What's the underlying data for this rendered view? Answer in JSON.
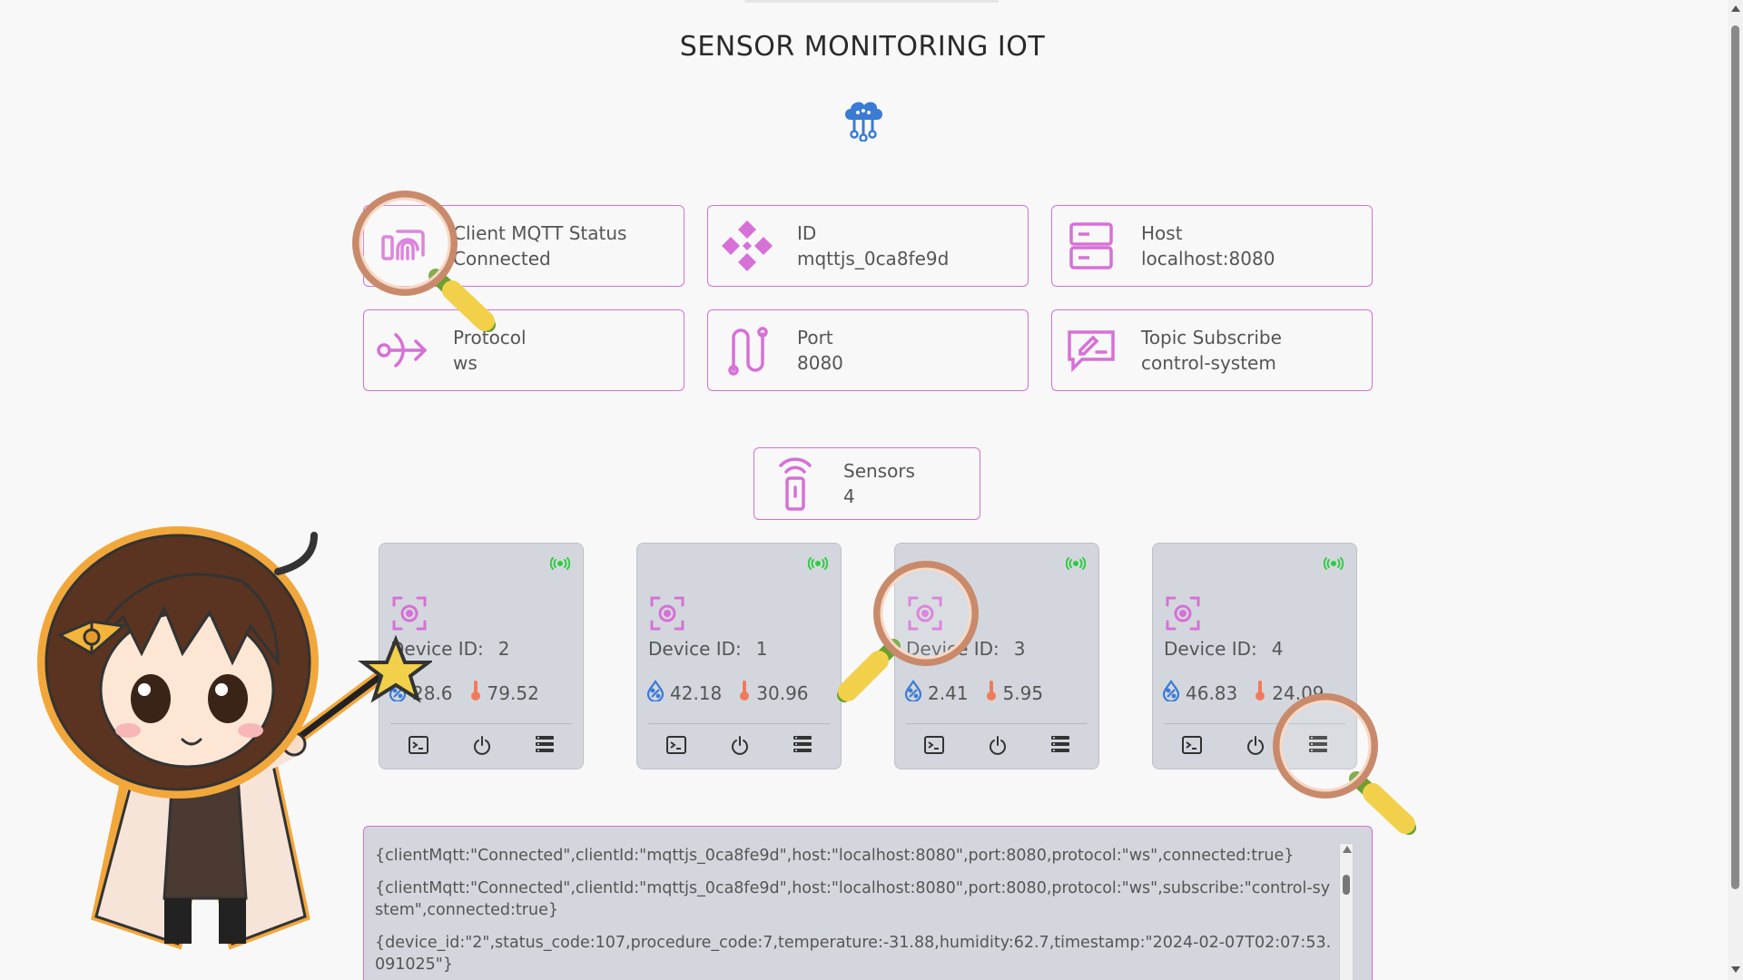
{
  "page": {
    "title": "SENSOR MONITORING IOT"
  },
  "icons": {
    "logo": "cloud-network-icon"
  },
  "info_cards": [
    {
      "label": "Client MQTT Status",
      "value": "Connected",
      "icon": "fingerprint-device-icon"
    },
    {
      "label": "ID",
      "value": "mqttjs_0ca8fe9d",
      "icon": "diamond-arrows-icon"
    },
    {
      "label": "Host",
      "value": "localhost:8080",
      "icon": "server-icon"
    },
    {
      "label": "Protocol",
      "value": "ws",
      "icon": "protocol-arrow-icon"
    },
    {
      "label": "Port",
      "value": "8080",
      "icon": "route-icon"
    },
    {
      "label": "Topic Subscribe",
      "value": "control-system",
      "icon": "signature-icon"
    }
  ],
  "sensors": {
    "label": "Sensors",
    "count": "4",
    "icon": "remote-sensor-icon"
  },
  "devices": [
    {
      "label": "Device ID:",
      "id": "2",
      "humidity": "28.6",
      "temperature": "79.52"
    },
    {
      "label": "Device ID:",
      "id": "1",
      "humidity": "42.18",
      "temperature": "30.96"
    },
    {
      "label": "Device ID:",
      "id": "3",
      "humidity": "2.41",
      "temperature": "5.95"
    },
    {
      "label": "Device ID:",
      "id": "4",
      "humidity": "46.83",
      "temperature": "24.09"
    }
  ],
  "colors": {
    "accent": "#d770d7",
    "card_bg": "#d3d7dd",
    "signal": "#2ecc40",
    "humidity": "#3a7bd5",
    "temperature": "#f27a5a"
  },
  "log_lines": [
    "{clientMqtt:\"Connected\",clientId:\"mqttjs_0ca8fe9d\",host:\"localhost:8080\",port:8080,protocol:\"ws\",connected:true}",
    "{clientMqtt:\"Connected\",clientId:\"mqttjs_0ca8fe9d\",host:\"localhost:8080\",port:8080,protocol:\"ws\",subscribe:\"control-system\",connected:true}",
    "{device_id:\"2\",status_code:107,procedure_code:7,temperature:-31.88,humidity:62.7,timestamp:\"2024-02-07T02:07:53.091025\"}"
  ]
}
